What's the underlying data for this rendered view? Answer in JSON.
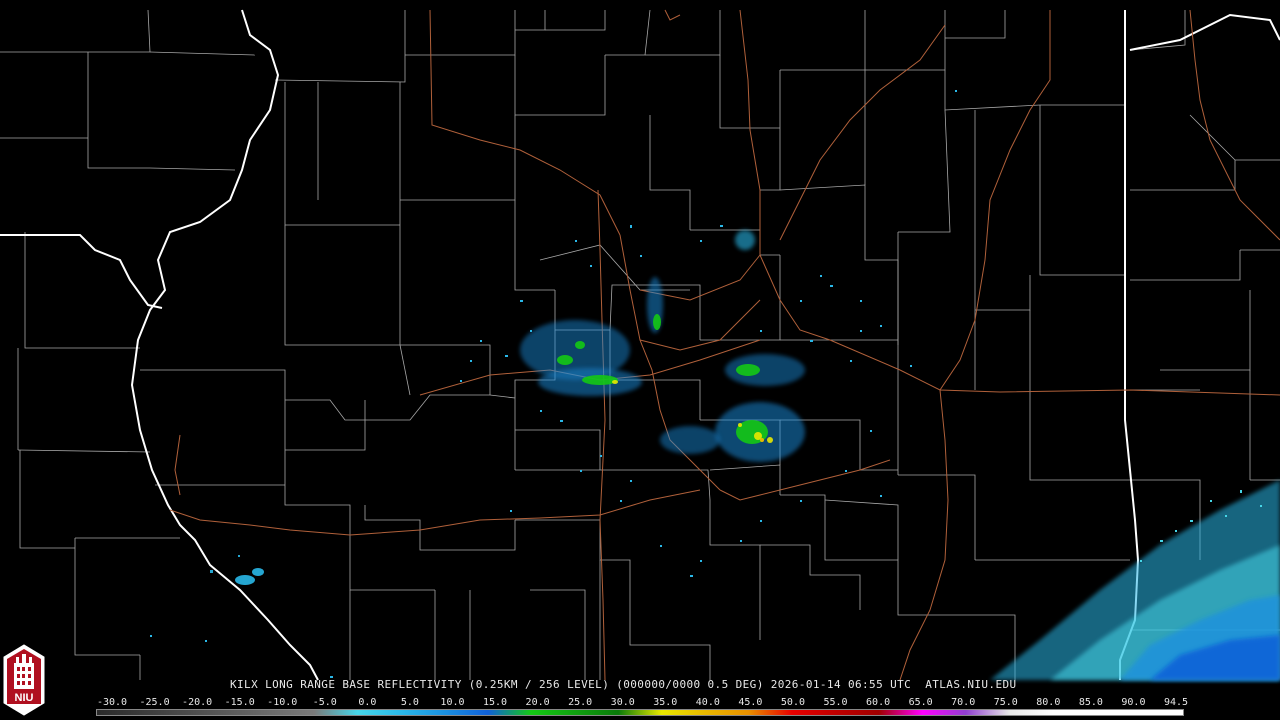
{
  "title": "KILX LONG RANGE BASE REFLECTIVITY (0.25KM / 256 LEVEL) (000000/0000 0.5 DEG) 2026-01-14 06:55 UTC  ATLAS.NIU.EDU",
  "logo": {
    "text": "NIU",
    "icon": "niu-tower-logo-icon"
  },
  "colors": {
    "background": "#000000",
    "county_lines": "#b0b0b0",
    "state_lines": "#ffffff",
    "highways": "#b0603a"
  },
  "scale": {
    "labels": [
      "-30.0",
      "-25.0",
      "-20.0",
      "-15.0",
      "-10.0",
      "-5.0",
      "0.0",
      "5.0",
      "10.0",
      "15.0",
      "20.0",
      "25.0",
      "30.0",
      "35.0",
      "40.0",
      "45.0",
      "50.0",
      "55.0",
      "60.0",
      "65.0",
      "70.0",
      "75.0",
      "80.0",
      "85.0",
      "90.0",
      "94.5"
    ],
    "colors": [
      "#2a2a2a",
      "#3a3a3a",
      "#4a4a4a",
      "#5a5a5a",
      "#6a6a6a",
      "#7a7a7a",
      "#46d6e8",
      "#2ab8e8",
      "#1a90e0",
      "#1060d8",
      "#14c814",
      "#10a010",
      "#0a7a0a",
      "#e8e800",
      "#e8b800",
      "#e89000",
      "#e80000",
      "#c00000",
      "#a00000",
      "#ff00ff",
      "#9040d0",
      "#e8e8e8",
      "#ffffff",
      "#ffffff",
      "#ffffff",
      "#ffffff"
    ]
  }
}
